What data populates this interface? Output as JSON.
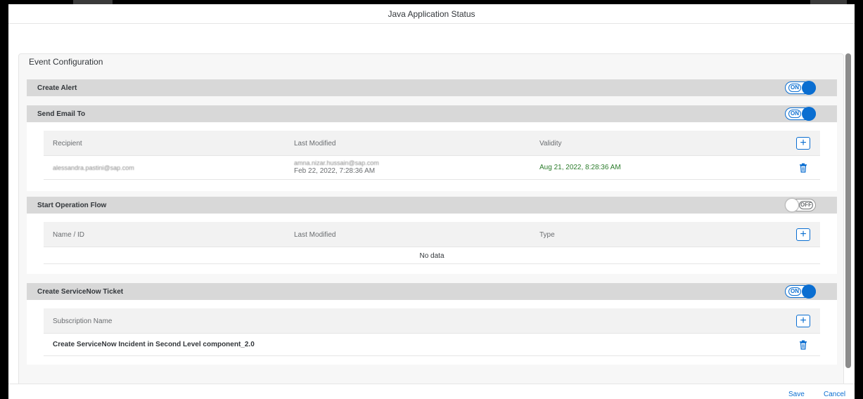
{
  "dialog": {
    "title": "Java Application Status"
  },
  "panel": {
    "title": "Event Configuration"
  },
  "sections": {
    "create_alert": {
      "title": "Create Alert",
      "toggle": "ON"
    },
    "send_email": {
      "title": "Send Email To",
      "toggle": "ON",
      "columns": [
        "Recipient",
        "Last Modified",
        "Validity"
      ],
      "rows": [
        {
          "recipient": "alessandra.pastini@sap.com",
          "modified_by": "amna.nizar.hussain@sap.com",
          "modified_at": "Feb 22, 2022, 7:28:36 AM",
          "validity": "Aug 21, 2022, 8:28:36 AM"
        }
      ]
    },
    "start_flow": {
      "title": "Start Operation Flow",
      "toggle": "OFF",
      "columns": [
        "Name / ID",
        "Last Modified",
        "Type"
      ],
      "empty": "No data"
    },
    "servicenow": {
      "title": "Create ServiceNow Ticket",
      "toggle": "ON",
      "columns": [
        "Subscription Name"
      ],
      "rows": [
        {
          "name": "Create ServiceNow Incident in Second Level component_2.0"
        }
      ]
    }
  },
  "footer": {
    "save": "Save",
    "cancel": "Cancel"
  },
  "colors": {
    "accent": "#0a6ed1",
    "validity": "#2b7c2b",
    "section_header": "#d8d8d8"
  },
  "icons": [
    "plus-icon",
    "trash-icon"
  ]
}
